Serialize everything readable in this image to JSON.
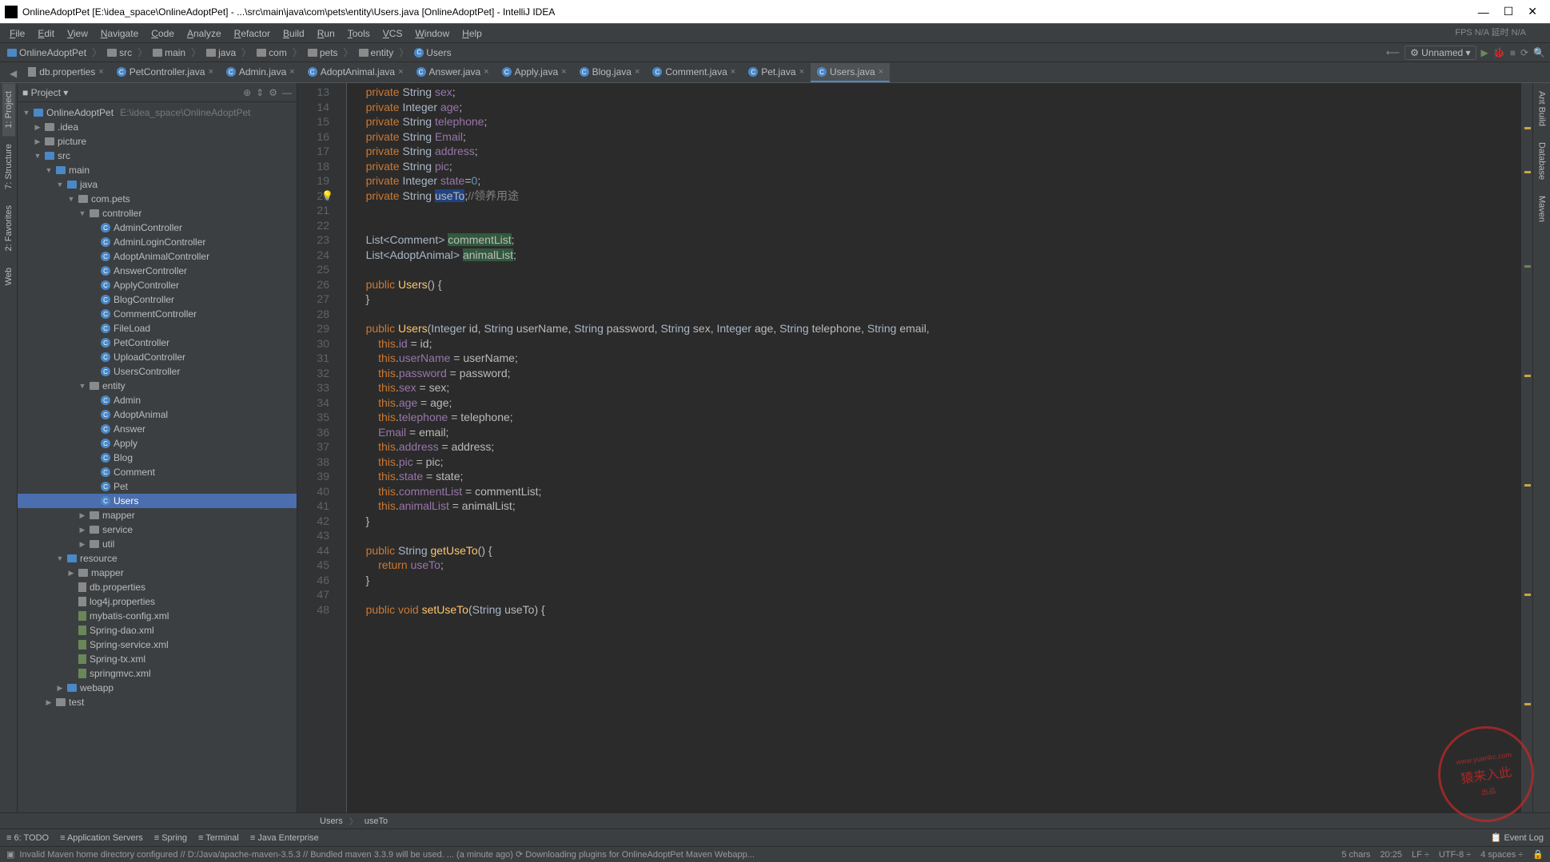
{
  "titlebar": {
    "title": "OnlineAdoptPet [E:\\idea_space\\OnlineAdoptPet] - ...\\src\\main\\java\\com\\pets\\entity\\Users.java [OnlineAdoptPet] - IntelliJ IDEA"
  },
  "fps_text": "FPS N/A 延时 N/A",
  "menu": [
    "File",
    "Edit",
    "View",
    "Navigate",
    "Code",
    "Analyze",
    "Refactor",
    "Build",
    "Run",
    "Tools",
    "VCS",
    "Window",
    "Help"
  ],
  "breadcrumbs": [
    "OnlineAdoptPet",
    "src",
    "main",
    "java",
    "com",
    "pets",
    "entity",
    "Users"
  ],
  "run_config": "Unnamed",
  "tabs": [
    {
      "label": "db.properties",
      "icon": "file"
    },
    {
      "label": "PetController.java",
      "icon": "class"
    },
    {
      "label": "Admin.java",
      "icon": "class"
    },
    {
      "label": "AdoptAnimal.java",
      "icon": "class"
    },
    {
      "label": "Answer.java",
      "icon": "class"
    },
    {
      "label": "Apply.java",
      "icon": "class"
    },
    {
      "label": "Blog.java",
      "icon": "class"
    },
    {
      "label": "Comment.java",
      "icon": "class"
    },
    {
      "label": "Pet.java",
      "icon": "class"
    },
    {
      "label": "Users.java",
      "icon": "class",
      "active": true
    }
  ],
  "project_header": "Project",
  "tree": [
    {
      "d": 0,
      "arrow": "▼",
      "icon": "folder-blue",
      "label": "OnlineAdoptPet",
      "meta": "E:\\idea_space\\OnlineAdoptPet"
    },
    {
      "d": 1,
      "arrow": "▶",
      "icon": "folder",
      "label": ".idea"
    },
    {
      "d": 1,
      "arrow": "▶",
      "icon": "folder",
      "label": "picture"
    },
    {
      "d": 1,
      "arrow": "▼",
      "icon": "folder-blue",
      "label": "src"
    },
    {
      "d": 2,
      "arrow": "▼",
      "icon": "folder-blue",
      "label": "main"
    },
    {
      "d": 3,
      "arrow": "▼",
      "icon": "folder-blue",
      "label": "java"
    },
    {
      "d": 4,
      "arrow": "▼",
      "icon": "folder",
      "label": "com.pets"
    },
    {
      "d": 5,
      "arrow": "▼",
      "icon": "folder",
      "label": "controller"
    },
    {
      "d": 6,
      "arrow": "",
      "icon": "class",
      "label": "AdminController"
    },
    {
      "d": 6,
      "arrow": "",
      "icon": "class",
      "label": "AdminLoginController"
    },
    {
      "d": 6,
      "arrow": "",
      "icon": "class",
      "label": "AdoptAnimalController"
    },
    {
      "d": 6,
      "arrow": "",
      "icon": "class",
      "label": "AnswerController"
    },
    {
      "d": 6,
      "arrow": "",
      "icon": "class",
      "label": "ApplyController"
    },
    {
      "d": 6,
      "arrow": "",
      "icon": "class",
      "label": "BlogController"
    },
    {
      "d": 6,
      "arrow": "",
      "icon": "class",
      "label": "CommentController"
    },
    {
      "d": 6,
      "arrow": "",
      "icon": "class",
      "label": "FileLoad"
    },
    {
      "d": 6,
      "arrow": "",
      "icon": "class",
      "label": "PetController"
    },
    {
      "d": 6,
      "arrow": "",
      "icon": "class",
      "label": "UploadController"
    },
    {
      "d": 6,
      "arrow": "",
      "icon": "class",
      "label": "UsersController"
    },
    {
      "d": 5,
      "arrow": "▼",
      "icon": "folder",
      "label": "entity"
    },
    {
      "d": 6,
      "arrow": "",
      "icon": "class",
      "label": "Admin"
    },
    {
      "d": 6,
      "arrow": "",
      "icon": "class",
      "label": "AdoptAnimal"
    },
    {
      "d": 6,
      "arrow": "",
      "icon": "class",
      "label": "Answer"
    },
    {
      "d": 6,
      "arrow": "",
      "icon": "class",
      "label": "Apply"
    },
    {
      "d": 6,
      "arrow": "",
      "icon": "class",
      "label": "Blog"
    },
    {
      "d": 6,
      "arrow": "",
      "icon": "class",
      "label": "Comment"
    },
    {
      "d": 6,
      "arrow": "",
      "icon": "class",
      "label": "Pet"
    },
    {
      "d": 6,
      "arrow": "",
      "icon": "class",
      "label": "Users",
      "selected": true
    },
    {
      "d": 5,
      "arrow": "▶",
      "icon": "folder",
      "label": "mapper"
    },
    {
      "d": 5,
      "arrow": "▶",
      "icon": "folder",
      "label": "service"
    },
    {
      "d": 5,
      "arrow": "▶",
      "icon": "folder",
      "label": "util"
    },
    {
      "d": 3,
      "arrow": "▼",
      "icon": "folder-blue",
      "label": "resource"
    },
    {
      "d": 4,
      "arrow": "▶",
      "icon": "folder",
      "label": "mapper"
    },
    {
      "d": 4,
      "arrow": "",
      "icon": "file",
      "label": "db.properties"
    },
    {
      "d": 4,
      "arrow": "",
      "icon": "file",
      "label": "log4j.properties"
    },
    {
      "d": 4,
      "arrow": "",
      "icon": "xml",
      "label": "mybatis-config.xml"
    },
    {
      "d": 4,
      "arrow": "",
      "icon": "xml",
      "label": "Spring-dao.xml"
    },
    {
      "d": 4,
      "arrow": "",
      "icon": "xml",
      "label": "Spring-service.xml"
    },
    {
      "d": 4,
      "arrow": "",
      "icon": "xml",
      "label": "Spring-tx.xml"
    },
    {
      "d": 4,
      "arrow": "",
      "icon": "xml",
      "label": "springmvc.xml"
    },
    {
      "d": 3,
      "arrow": "▶",
      "icon": "folder-blue",
      "label": "webapp"
    },
    {
      "d": 2,
      "arrow": "▶",
      "icon": "folder",
      "label": "test"
    }
  ],
  "lines_start": 13,
  "code_lines": [
    {
      "html": "    <span class='kw'>private</span> <span class='type'>String</span> <span class='field'>sex</span>;"
    },
    {
      "html": "    <span class='kw'>private</span> <span class='type'>Integer</span> <span class='field'>age</span>;"
    },
    {
      "html": "    <span class='kw'>private</span> <span class='type'>String</span> <span class='field'>telephone</span>;"
    },
    {
      "html": "    <span class='kw'>private</span> <span class='type'>String</span> <span class='field'>Email</span>;"
    },
    {
      "html": "    <span class='kw'>private</span> <span class='type'>String</span> <span class='field'>address</span>;"
    },
    {
      "html": "    <span class='kw'>private</span> <span class='type'>String</span> <span class='field'>pic</span>;"
    },
    {
      "html": "    <span class='kw'>private</span> <span class='type'>Integer</span> <span class='field'>state</span>=<span class='num'>0</span>;"
    },
    {
      "html": "    <span class='kw'>private</span> <span class='type'>String</span> <span class='sel'>useTo</span>;<span class='comment'>//领养用途</span>",
      "bulb": true
    },
    {
      "html": ""
    },
    {
      "html": ""
    },
    {
      "html": "    <span class='type'>List&lt;Comment&gt;</span> <span class='hl'>commentList</span>;"
    },
    {
      "html": "    <span class='type'>List&lt;AdoptAnimal&gt;</span> <span class='hl'>animalList</span>;"
    },
    {
      "html": ""
    },
    {
      "html": "    <span class='kw'>public</span> <span class='method'>Users</span>() {"
    },
    {
      "html": "    }"
    },
    {
      "html": ""
    },
    {
      "html": "    <span class='kw'>public</span> <span class='method'>Users</span>(<span class='type'>Integer</span> id, <span class='type'>String</span> userName, <span class='type'>String</span> password, <span class='type'>String</span> sex, <span class='type'>Integer</span> age, <span class='type'>String</span> telephone, <span class='type'>String</span> email,"
    },
    {
      "html": "        <span class='this'>this</span>.<span class='field'>id</span> = id;"
    },
    {
      "html": "        <span class='this'>this</span>.<span class='field'>userName</span> = userName;"
    },
    {
      "html": "        <span class='this'>this</span>.<span class='field'>password</span> = password;"
    },
    {
      "html": "        <span class='this'>this</span>.<span class='field'>sex</span> = sex;"
    },
    {
      "html": "        <span class='this'>this</span>.<span class='field'>age</span> = age;"
    },
    {
      "html": "        <span class='this'>this</span>.<span class='field'>telephone</span> = telephone;"
    },
    {
      "html": "        <span class='field'>Email</span> = email;"
    },
    {
      "html": "        <span class='this'>this</span>.<span class='field'>address</span> = address;"
    },
    {
      "html": "        <span class='this'>this</span>.<span class='field'>pic</span> = pic;"
    },
    {
      "html": "        <span class='this'>this</span>.<span class='field'>state</span> = state;"
    },
    {
      "html": "        <span class='this'>this</span>.<span class='field'>commentList</span> = commentList;"
    },
    {
      "html": "        <span class='this'>this</span>.<span class='field'>animalList</span> = animalList;"
    },
    {
      "html": "    }"
    },
    {
      "html": ""
    },
    {
      "html": "    <span class='kw'>public</span> <span class='type'>String</span> <span class='method'>getUseTo</span>() {"
    },
    {
      "html": "        <span class='kw'>return</span> <span class='field'>useTo</span>;"
    },
    {
      "html": "    }"
    },
    {
      "html": ""
    },
    {
      "html": "    <span class='kw'>public void</span> <span class='method'>setUseTo</span>(<span class='type'>String</span> useTo) {"
    }
  ],
  "ed_breadcrumb": [
    "Users",
    "useTo"
  ],
  "left_tabs": [
    "1: Project",
    "7: Structure",
    "2: Favorites",
    "Web"
  ],
  "right_tabs": [
    "Ant Build",
    "Database",
    "Maven"
  ],
  "bottom_tabs": [
    "6: TODO",
    "Application Servers",
    "Spring",
    "Terminal",
    "Java Enterprise"
  ],
  "event_log": "Event Log",
  "status_left": "Invalid Maven home directory configured // D:/Java/apache-maven-3.5.3 // Bundled maven 3.3.9 will be used. ... (a minute ago)   ⟳ Downloading plugins for OnlineAdoptPet Maven Webapp...",
  "status_right": [
    "5 chars",
    "20:25",
    "LF ÷",
    "UTF-8 ÷",
    "4 spaces ÷"
  ],
  "watermark": "猿来入此"
}
